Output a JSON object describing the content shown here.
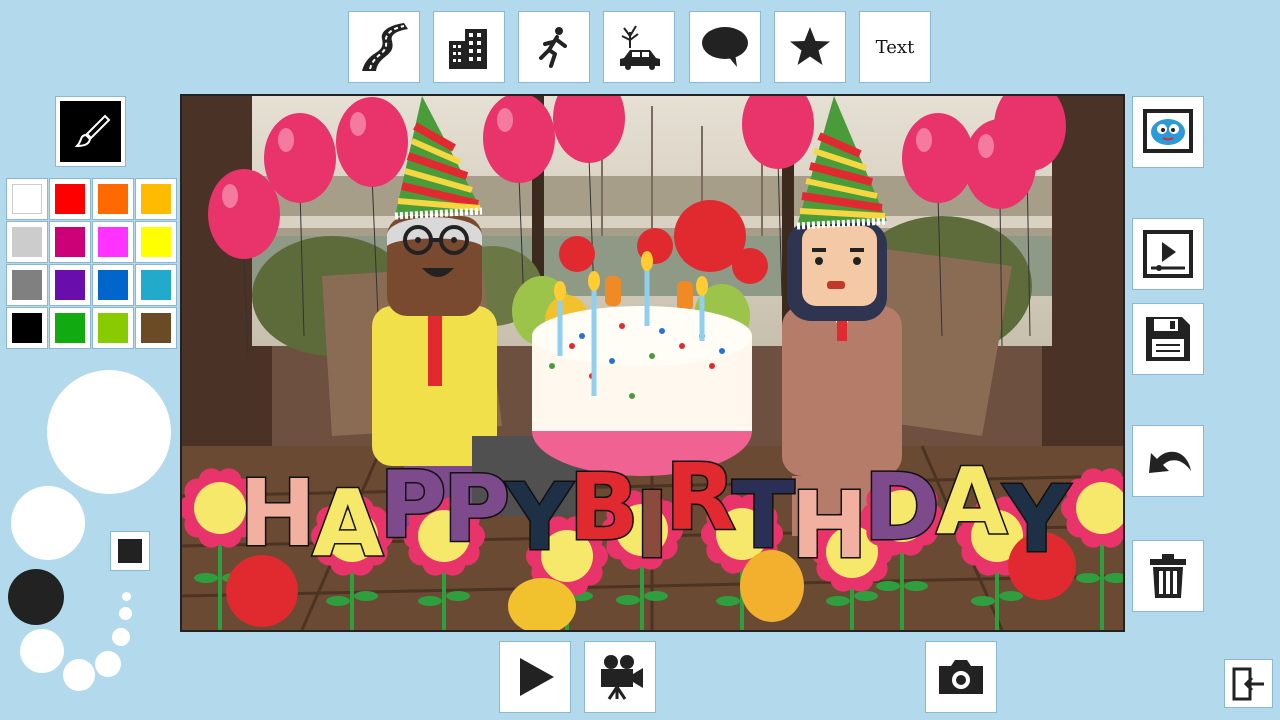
{
  "toolbar": {
    "top": [
      {
        "name": "road-tool-button",
        "icon": "road-icon"
      },
      {
        "name": "buildings-tool-button",
        "icon": "buildings-icon"
      },
      {
        "name": "characters-tool-button",
        "icon": "running-person-icon"
      },
      {
        "name": "scene-tool-button",
        "icon": "tree-car-icon"
      },
      {
        "name": "speech-bubble-tool-button",
        "icon": "speech-bubble-icon"
      },
      {
        "name": "star-tool-button",
        "icon": "star-icon"
      },
      {
        "name": "text-tool-button",
        "label": "Text"
      }
    ],
    "right": [
      {
        "name": "mascot-gallery-button",
        "icon": "mascot-icon"
      },
      {
        "name": "play-slideshow-button",
        "icon": "video-player-icon"
      },
      {
        "name": "save-button",
        "icon": "floppy-disk-icon"
      },
      {
        "name": "undo-button",
        "icon": "undo-icon"
      },
      {
        "name": "delete-button",
        "icon": "trash-icon"
      }
    ],
    "bottom": [
      {
        "name": "play-button",
        "icon": "play-icon"
      },
      {
        "name": "record-video-button",
        "icon": "movie-camera-icon"
      },
      {
        "name": "screenshot-button",
        "icon": "camera-icon"
      }
    ],
    "exit": {
      "name": "exit-button",
      "icon": "exit-door-icon"
    }
  },
  "brush": {
    "icon": "paintbrush-icon",
    "selected_size": "small"
  },
  "palette": [
    "#ffffff",
    "#ff0000",
    "#ff6a00",
    "#ffbb00",
    "#cccccc",
    "#cc0077",
    "#ff33ff",
    "#ffff00",
    "#808080",
    "#6a0dad",
    "#0066cc",
    "#22aacc",
    "#000000",
    "#11aa11",
    "#88cc00",
    "#6b4a26"
  ],
  "canvas": {
    "title_letters": [
      {
        "ch": "H",
        "color": "#f2b0a0"
      },
      {
        "ch": "A",
        "color": "#f5e86a"
      },
      {
        "ch": "P",
        "color": "#7d4a8c"
      },
      {
        "ch": "P",
        "color": "#7d4a8c"
      },
      {
        "ch": "Y",
        "color": "#1d3046"
      },
      {
        "ch": "B",
        "color": "#e02a30"
      },
      {
        "ch": "I",
        "color": "#8a4a3c"
      },
      {
        "ch": "R",
        "color": "#e02a30"
      },
      {
        "ch": "T",
        "color": "#2a2f55"
      },
      {
        "ch": "H",
        "color": "#f2b0a0"
      },
      {
        "ch": "D",
        "color": "#7d4a8c"
      },
      {
        "ch": "A",
        "color": "#f5e86a"
      },
      {
        "ch": "Y",
        "color": "#1d3046"
      }
    ]
  }
}
